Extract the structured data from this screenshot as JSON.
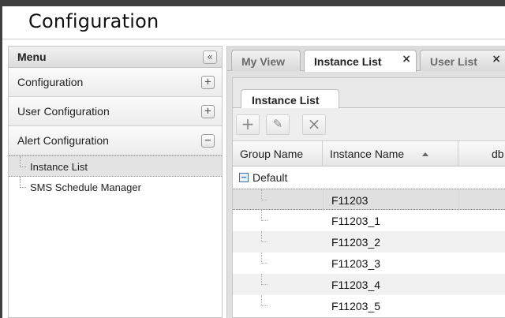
{
  "page": {
    "title": "Configuration"
  },
  "menu": {
    "title": "Menu",
    "collapse_glyph": "«",
    "sections": [
      {
        "label": "Configuration",
        "toggle": "+"
      },
      {
        "label": "User Configuration",
        "toggle": "+"
      },
      {
        "label": "Alert Configuration",
        "toggle": "−"
      }
    ],
    "alert_items": [
      {
        "label": "Instance List",
        "selected": true
      },
      {
        "label": "SMS Schedule Manager",
        "selected": false
      }
    ]
  },
  "tabs": [
    {
      "label": "My View",
      "closable": false,
      "active": false
    },
    {
      "label": "Instance List",
      "closable": true,
      "active": true
    },
    {
      "label": "User List",
      "closable": true,
      "active": false
    }
  ],
  "tab_close_glyph": "×",
  "inner": {
    "tab_label": "Instance List",
    "toolbar": {
      "add_glyph": "+",
      "edit_glyph": "✎",
      "delete_glyph": "×"
    },
    "columns": {
      "group": "Group Name",
      "instance": "Instance Name",
      "next": "db"
    },
    "group": {
      "toggle": "−",
      "label": "Default"
    },
    "rows": [
      {
        "instance": "F11203"
      },
      {
        "instance": "F11203_1"
      },
      {
        "instance": "F11203_2"
      },
      {
        "instance": "F11203_3"
      },
      {
        "instance": "F11203_4"
      },
      {
        "instance": "F11203_5"
      }
    ]
  },
  "colors": {
    "background": "#3f3f3f",
    "selected_row": "#e0e0e0",
    "group_toggle": "#3d6fb5"
  }
}
